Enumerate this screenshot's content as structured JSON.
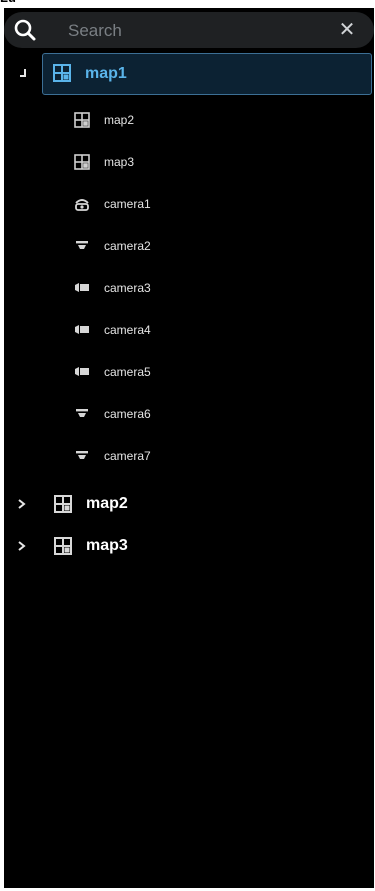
{
  "header": {
    "cut_title": "Lu"
  },
  "search": {
    "placeholder": "Search",
    "clear_label": "✕"
  },
  "tree": {
    "root": {
      "label": "map1",
      "expanded": true,
      "selected": true,
      "icon": "map-icon"
    },
    "children": [
      {
        "label": "map2",
        "icon": "map-icon"
      },
      {
        "label": "map3",
        "icon": "map-icon"
      },
      {
        "label": "camera1",
        "icon": "camera-dome-icon"
      },
      {
        "label": "camera2",
        "icon": "camera-ceiling-icon"
      },
      {
        "label": "camera3",
        "icon": "camera-box-icon"
      },
      {
        "label": "camera4",
        "icon": "camera-box-icon"
      },
      {
        "label": "camera5",
        "icon": "camera-box-icon"
      },
      {
        "label": "camera6",
        "icon": "camera-ceiling-icon"
      },
      {
        "label": "camera7",
        "icon": "camera-ceiling-icon"
      }
    ],
    "others": [
      {
        "label": "map2",
        "expanded": false,
        "icon": "map-icon"
      },
      {
        "label": "map3",
        "expanded": false,
        "icon": "map-icon"
      }
    ]
  },
  "colors": {
    "accent": "#5ab4ea",
    "selection_bg": "#0c2233",
    "panel_bg": "#000000"
  }
}
